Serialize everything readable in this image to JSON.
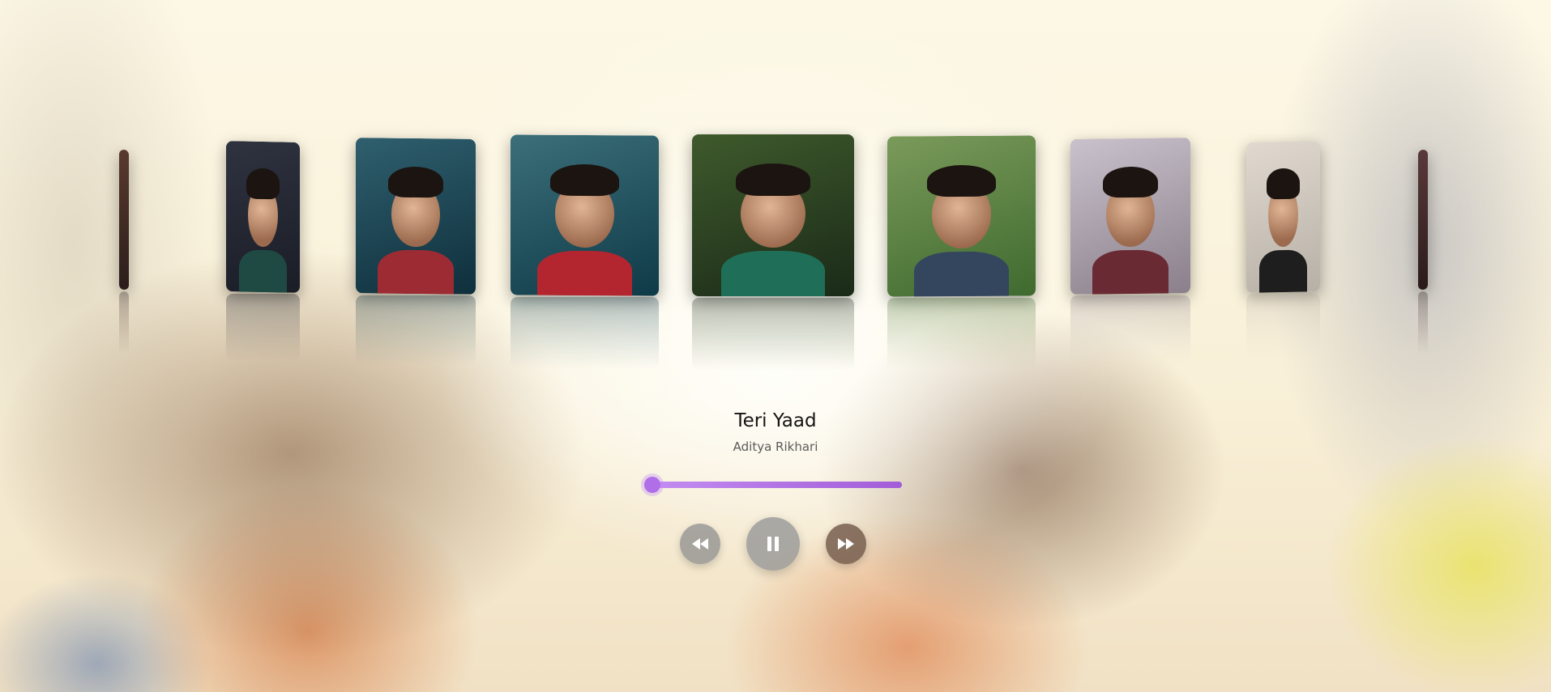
{
  "player": {
    "track_title": "Teri Yaad",
    "artist": "Aditya Rikhari",
    "progress_fraction": 0.03
  },
  "controls": {
    "rewind_icon": "rewind-icon",
    "play_icon": "pause-icon",
    "forward_icon": "fast-forward-icon"
  },
  "covers": [
    {
      "name": "album-cover-1",
      "colors": [
        "#2a1d1b",
        "#5a3a2e"
      ],
      "body": "#3a2a25"
    },
    {
      "name": "album-cover-2",
      "colors": [
        "#1a1d26",
        "#2f3340"
      ],
      "body": "#1f4a44"
    },
    {
      "name": "album-cover-3",
      "colors": [
        "#0f2f3c",
        "#2f5f6e"
      ],
      "body": "#9c2b34"
    },
    {
      "name": "album-cover-4",
      "colors": [
        "#0f3a48",
        "#3b6f7a"
      ],
      "body": "#b3262f"
    },
    {
      "name": "album-cover-5",
      "colors": [
        "#1a2a18",
        "#3f5a2c"
      ],
      "body": "#1f6f58"
    },
    {
      "name": "album-cover-6",
      "colors": [
        "#3f6a2f",
        "#7a9a5a"
      ],
      "body": "#34465e"
    },
    {
      "name": "album-cover-7",
      "colors": [
        "#8a7f8a",
        "#c9c2cc"
      ],
      "body": "#6a2a34"
    },
    {
      "name": "album-cover-8",
      "colors": [
        "#b7b0a6",
        "#e0d9cf"
      ],
      "body": "#1e1e1e"
    },
    {
      "name": "album-cover-9",
      "colors": [
        "#2a1a1a",
        "#5a3a3a"
      ],
      "body": "#3a2020"
    }
  ]
}
